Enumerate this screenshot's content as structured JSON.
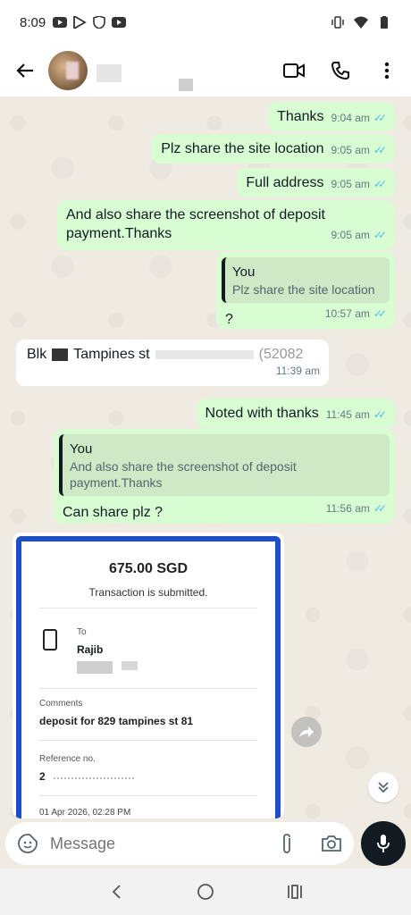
{
  "status_bar": {
    "time": "8:09"
  },
  "header": {
    "back_icon": "arrow-left-icon",
    "video_icon": "video-call-icon",
    "call_icon": "phone-icon",
    "menu_icon": "more-vert-icon"
  },
  "messages": [
    {
      "dir": "out",
      "text": "Thanks",
      "time": "9:04 am"
    },
    {
      "dir": "out",
      "text": "Plz share the site location",
      "time": "9:05 am"
    },
    {
      "dir": "out",
      "text": "Full address",
      "time": "9:05 am"
    },
    {
      "dir": "out",
      "text_line1": "And also share the screenshot of deposit",
      "text_line2": "payment.Thanks",
      "time": "9:05 am"
    },
    {
      "dir": "out",
      "quote_author": "You",
      "quote_text": "Plz share the site location",
      "text": "?",
      "time": "10:57 am"
    },
    {
      "dir": "in",
      "text_a": "Blk",
      "text_b": "Tampines st",
      "text_c": "(52082",
      "time": "11:39 am"
    },
    {
      "dir": "out",
      "text": "Noted with thanks",
      "time": "11:45 am"
    },
    {
      "dir": "out",
      "quote_author": "You",
      "quote_text_line1": "And also share the screenshot of deposit",
      "quote_text_line2": "payment.Thanks",
      "text": "Can share plz ?",
      "time": "11:56 am"
    }
  ],
  "receipt": {
    "amount": "675.00 SGD",
    "status": "Transaction is submitted.",
    "to_label": "To",
    "to_name": "Rajib",
    "comments_label": "Comments",
    "comments_value": "deposit for 829 tampines st 81",
    "reference_label": "Reference no.",
    "reference_value": "2",
    "datetime": "01 Apr 2026, 02:28 PM"
  },
  "composer": {
    "placeholder": "Message"
  }
}
